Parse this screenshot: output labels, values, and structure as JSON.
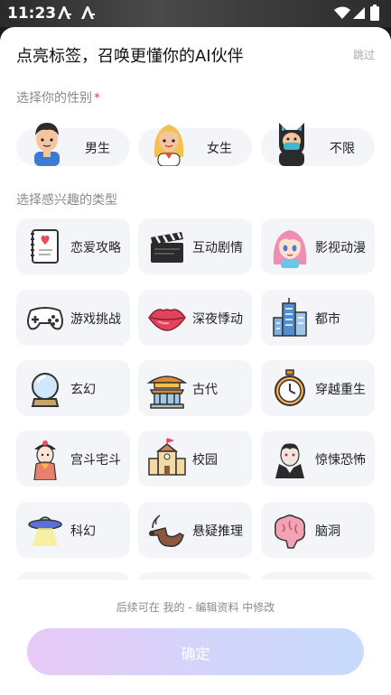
{
  "status_bar": {
    "time": "11:23",
    "icons": [
      "a-logo-icon",
      "a-logo-icon",
      "wifi-icon",
      "signal-icon",
      "battery-icon"
    ]
  },
  "header": {
    "title": "点亮标签，召唤更懂你的AI伙伴",
    "skip_label": "跳过"
  },
  "gender_section": {
    "label": "选择你的性别",
    "required_mark": "*",
    "options": [
      {
        "label": "男生",
        "icon": "boy-avatar-icon"
      },
      {
        "label": "女生",
        "icon": "girl-avatar-icon"
      },
      {
        "label": "不限",
        "icon": "cat-ninja-avatar-icon"
      }
    ]
  },
  "interest_section": {
    "label": "选择感兴趣的类型",
    "items": [
      {
        "label": "恋爱攻略",
        "icon": "love-diary-icon"
      },
      {
        "label": "互动剧情",
        "icon": "clapperboard-icon"
      },
      {
        "label": "影视动漫",
        "icon": "anime-girl-icon"
      },
      {
        "label": "游戏挑战",
        "icon": "gamepad-icon"
      },
      {
        "label": "深夜悸动",
        "icon": "lips-icon"
      },
      {
        "label": "都市",
        "icon": "city-buildings-icon"
      },
      {
        "label": "玄幻",
        "icon": "crystal-ball-icon"
      },
      {
        "label": "古代",
        "icon": "pagoda-icon"
      },
      {
        "label": "穿越重生",
        "icon": "stopwatch-icon"
      },
      {
        "label": "宫斗宅斗",
        "icon": "palace-lady-icon"
      },
      {
        "label": "校园",
        "icon": "school-building-icon"
      },
      {
        "label": "惊悚恐怖",
        "icon": "vampire-icon"
      },
      {
        "label": "科幻",
        "icon": "ufo-icon"
      },
      {
        "label": "悬疑推理",
        "icon": "detective-pipe-icon"
      },
      {
        "label": "脑洞",
        "icon": "brain-icon"
      },
      {
        "label": "",
        "icon": "partial-icon"
      },
      {
        "label": "",
        "icon": "partial-icon"
      },
      {
        "label": "",
        "icon": "partial-icon"
      }
    ]
  },
  "footer": {
    "hint": "后续可在 我的 - 编辑资料 中修改",
    "confirm_label": "确定"
  },
  "colors": {
    "card_bg": "#f4f5f9",
    "button_gradient": [
      "#e8c9f7",
      "#c7dbfb"
    ],
    "required": "#ff3b30"
  }
}
